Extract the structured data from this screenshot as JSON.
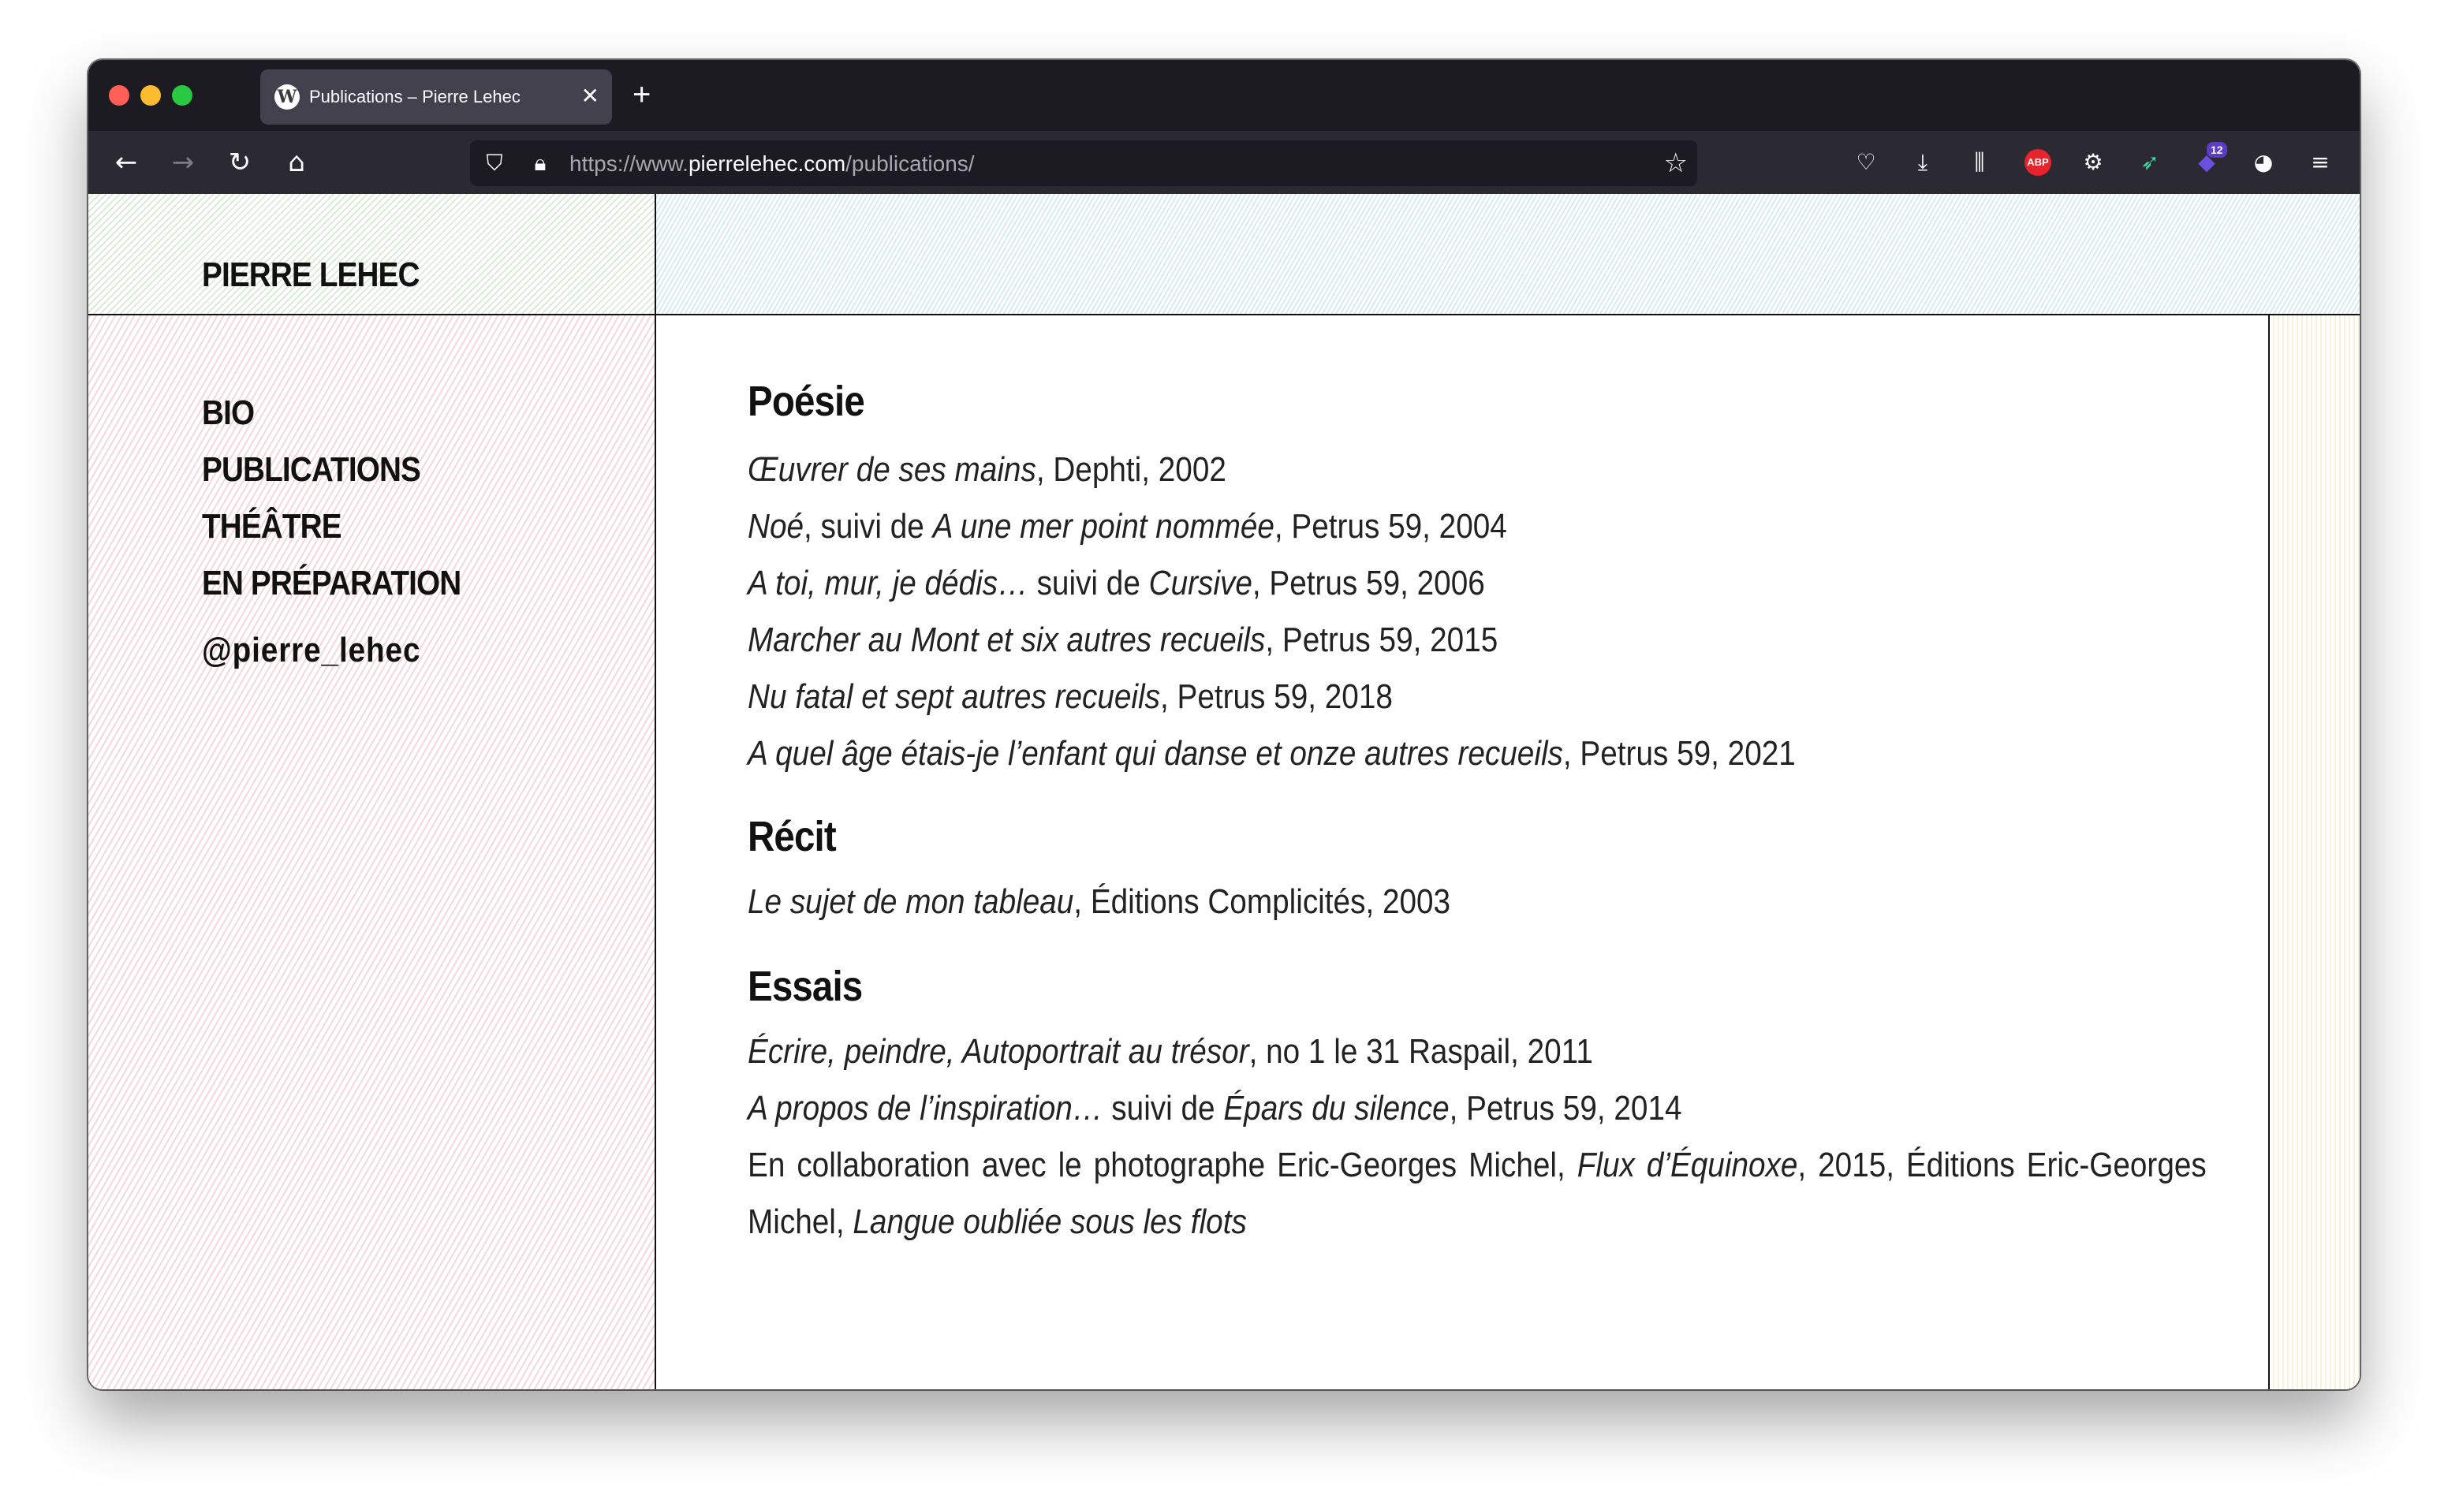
{
  "browser": {
    "tab_title": "Publications – Pierre Lehec",
    "favicon": "W",
    "url_prefix": "https://www.",
    "url_host": "pierrelehec.com",
    "url_path": "/publications/",
    "badge_count": "12",
    "abp_label": "ABP"
  },
  "site": {
    "title": "PIERRE LEHEC"
  },
  "menu": {
    "items": [
      "BIO",
      "PUBLICATIONS",
      "THÉÂTRE",
      "EN PRÉPARATION"
    ],
    "handle": "@pierre_lehec"
  },
  "sections": {
    "poesie": {
      "heading": "Poésie",
      "entries": [
        {
          "t1": "Œuvrer de ses mains",
          "r1": ", Dephti, 2002"
        },
        {
          "t1": "Noé",
          "r1": ", suivi de ",
          "t2": "A une mer point nommée",
          "r2": ", Petrus 59, 2004"
        },
        {
          "t1": "A toi, mur, je dédis…",
          "r1": " suivi de ",
          "t2": "Cursive",
          "r2": ", Petrus 59, 2006"
        },
        {
          "t1": "Marcher au Mont et six autres recueils",
          "r1": ", Petrus 59, 2015"
        },
        {
          "t1": "Nu fatal et sept autres recueils",
          "r1": ", Petrus 59, 2018"
        },
        {
          "t1": "A quel âge étais-je l’enfant qui danse et onze autres recueils",
          "r1": ", Petrus 59, 2021"
        }
      ]
    },
    "recit": {
      "heading": "Récit",
      "entries": [
        {
          "t1": "Le sujet de mon tableau",
          "r1": ", Éditions Complicités, 2003"
        }
      ]
    },
    "essais": {
      "heading": "Essais",
      "entries": [
        {
          "t1": "Écrire, peindre, Autoportrait au trésor",
          "r1": ", no 1 le 31 Raspail, 2011"
        },
        {
          "t1": "A propos de l’inspiration…",
          "r1": " suivi de ",
          "t2": "Épars du silence",
          "r2": ", Petrus 59, 2014"
        },
        {
          "r0": "En collaboration avec le photographe Eric-Georges Michel, ",
          "t1": "Flux d’Équinoxe",
          "r1": ", 2015, Éditions Eric-Georges Michel, ",
          "t2": "Langue oubliée sous les flots"
        }
      ]
    }
  }
}
